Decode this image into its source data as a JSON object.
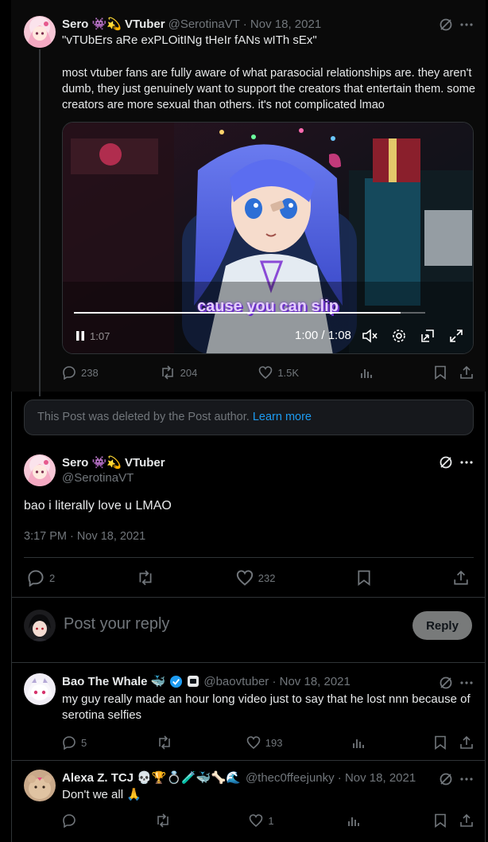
{
  "quoted_post": {
    "display_name": "Sero 👾💫 VTuber",
    "handle_time": "@SerotinaVT · Nov 18, 2021",
    "line1": "\"vTUbErs aRe exPLOitINg tHeIr fANs wITh sEx\"",
    "body": "most vtuber fans are fully aware of what parasocial relationships are. they aren't dumb, they just genuinely want to support the creators that entertain them. some creators are more sexual than others. it's not complicated lmao",
    "video": {
      "caption": "cause you can slip",
      "time": "1:00 / 1:08",
      "left_time": "1:07",
      "progress": 0.93
    },
    "stats": {
      "replies": "238",
      "reposts": "204",
      "likes": "1.5K"
    }
  },
  "deleted_notice": {
    "text": "This Post was deleted by the Post author.",
    "link": "Learn more"
  },
  "main_post": {
    "display_name": "Sero 👾💫 VTuber",
    "handle": "@SerotinaVT",
    "text": "bao i literally love u LMAO",
    "timestamp": "3:17 PM · Nov 18, 2021",
    "stats": {
      "replies": "2",
      "likes": "232"
    }
  },
  "reply_box": {
    "placeholder": "Post your reply",
    "button": "Reply"
  },
  "replies": [
    {
      "display_name": "Bao The Whale 🐳",
      "handle_time": "@baovtuber · Nov 18, 2021",
      "text": "my guy really made an hour long video just to say that he lost nnn because of serotina selfies",
      "stats": {
        "replies": "5",
        "reposts": "",
        "likes": "193"
      }
    },
    {
      "display_name": "Alexa Z. TCJ 💀🏆💍🧪🐳🦴🌊",
      "handle_time": "@thec0ffeejunky · Nov 18, 2021",
      "text": "Don't we all 🙏",
      "stats": {
        "replies": "",
        "reposts": "",
        "likes": "1"
      }
    }
  ],
  "colors": {
    "background": "#000000",
    "accent": "#1d9bf0",
    "muted": "#71767b",
    "border": "#2f3336"
  }
}
